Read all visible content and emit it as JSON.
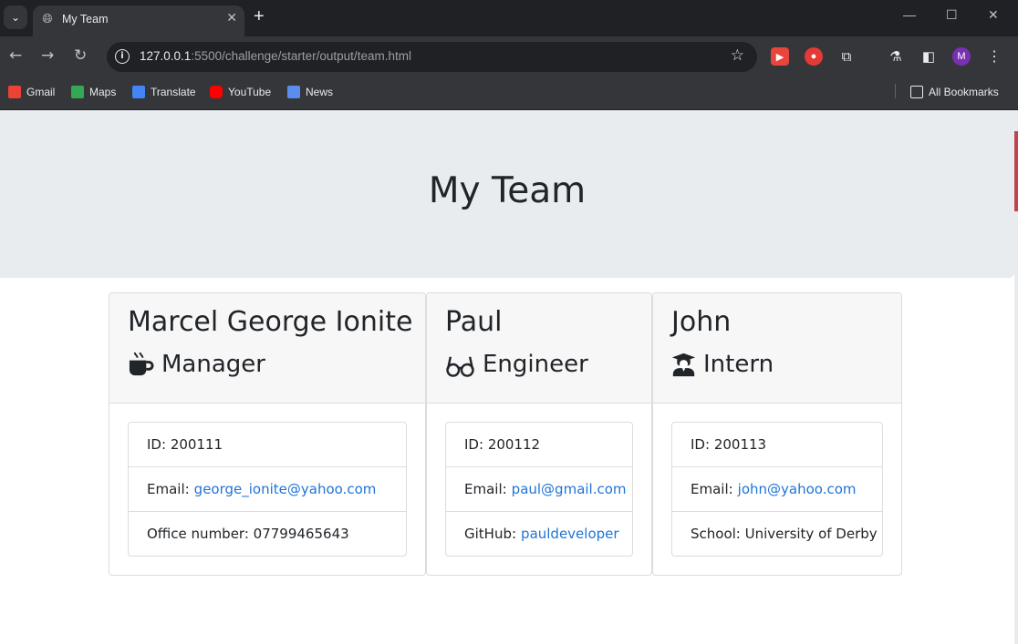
{
  "browser": {
    "tab_title": "My Team",
    "url_host": "127.0.0.1",
    "url_rest": ":5500/challenge/starter/output/team.html",
    "profile_initial": "M",
    "bookmarks": [
      "Gmail",
      "Maps",
      "Translate",
      "YouTube",
      "News"
    ],
    "all_bookmarks": "All Bookmarks"
  },
  "header": {
    "title": "My Team"
  },
  "cards": [
    {
      "name": "Marcel George Ionite",
      "role": "Manager",
      "role_icon": "mug-hot-icon",
      "id_label": "ID:",
      "id": "200111",
      "email_label": "Email:",
      "email": "george_ionite@yahoo.com",
      "extra_label": "Office number:",
      "extra": "07799465643"
    },
    {
      "name": "Paul",
      "role": "Engineer",
      "role_icon": "glasses-icon",
      "id_label": "ID:",
      "id": "200112",
      "email_label": "Email:",
      "email": "paul@gmail.com",
      "extra_label": "GitHub:",
      "extra": "pauldeveloper"
    },
    {
      "name": "John",
      "role": "Intern",
      "role_icon": "graduate-icon",
      "id_label": "ID:",
      "id": "200113",
      "email_label": "Email:",
      "email": "john@yahoo.com",
      "extra_label": "School:",
      "extra": "University of Derby"
    }
  ],
  "colors": {
    "jumbotron": "#e9ecef",
    "link": "#1f74d6",
    "chrome_dark": "#202124",
    "chrome": "#35363a"
  }
}
